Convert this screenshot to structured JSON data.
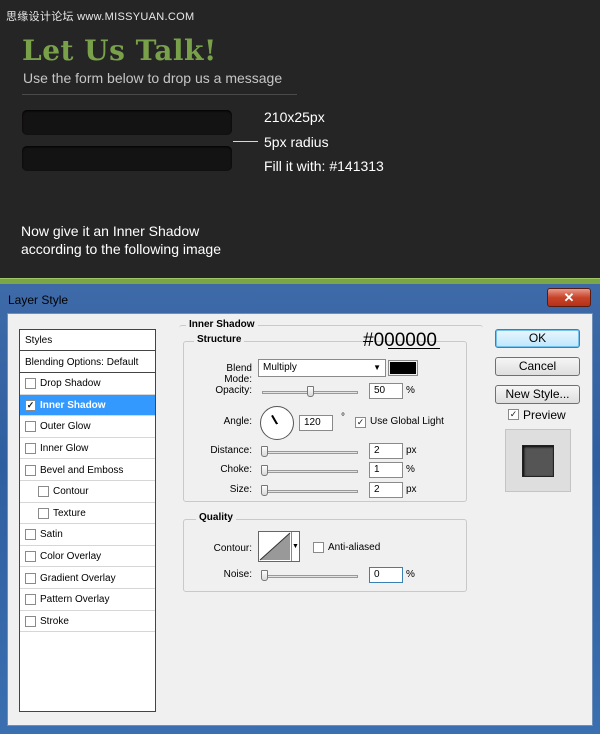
{
  "watermark": "思缘设计论坛 www.MISSYUAN.COM",
  "tutorial": {
    "title": "Let Us Talk!",
    "subtitle": "Use the form below to drop us a message",
    "annotations": [
      "210x25px",
      "5px radius",
      "Fill it with: #141313"
    ],
    "instruction_line1": "Now give it an Inner Shadow",
    "instruction_line2": "according to the following image",
    "field_fill_color": "#141313",
    "title_color": "#79a14a"
  },
  "dialog": {
    "title": "Layer Style",
    "close_label": "✕",
    "styles_header": "Styles",
    "styles_list": [
      {
        "label": "Blending Options: Default",
        "checkbox": false,
        "checked": false,
        "selected": false,
        "indent": false
      },
      {
        "label": "Drop Shadow",
        "checkbox": true,
        "checked": false,
        "selected": false,
        "indent": false
      },
      {
        "label": "Inner Shadow",
        "checkbox": true,
        "checked": true,
        "selected": true,
        "indent": false
      },
      {
        "label": "Outer Glow",
        "checkbox": true,
        "checked": false,
        "selected": false,
        "indent": false
      },
      {
        "label": "Inner Glow",
        "checkbox": true,
        "checked": false,
        "selected": false,
        "indent": false
      },
      {
        "label": "Bevel and Emboss",
        "checkbox": true,
        "checked": false,
        "selected": false,
        "indent": false
      },
      {
        "label": "Contour",
        "checkbox": true,
        "checked": false,
        "selected": false,
        "indent": true
      },
      {
        "label": "Texture",
        "checkbox": true,
        "checked": false,
        "selected": false,
        "indent": true
      },
      {
        "label": "Satin",
        "checkbox": true,
        "checked": false,
        "selected": false,
        "indent": false
      },
      {
        "label": "Color Overlay",
        "checkbox": true,
        "checked": false,
        "selected": false,
        "indent": false
      },
      {
        "label": "Gradient Overlay",
        "checkbox": true,
        "checked": false,
        "selected": false,
        "indent": false
      },
      {
        "label": "Pattern Overlay",
        "checkbox": true,
        "checked": false,
        "selected": false,
        "indent": false
      },
      {
        "label": "Stroke",
        "checkbox": true,
        "checked": false,
        "selected": false,
        "indent": false
      }
    ],
    "panel_title": "Inner Shadow",
    "structure": {
      "label": "Structure",
      "color_note": "#000000",
      "blend_mode_label": "Blend Mode:",
      "blend_mode_value": "Multiply",
      "swatch_color": "#000000",
      "opacity_label": "Opacity:",
      "opacity_value": "50",
      "opacity_unit": "%",
      "angle_label": "Angle:",
      "angle_value": "120",
      "angle_unit": "°",
      "global_light_label": "Use Global Light",
      "distance_label": "Distance:",
      "distance_value": "2",
      "distance_unit": "px",
      "choke_label": "Choke:",
      "choke_value": "1",
      "choke_unit": "%",
      "size_label": "Size:",
      "size_value": "2",
      "size_unit": "px"
    },
    "quality": {
      "label": "Quality",
      "contour_label": "Contour:",
      "anti_aliased_label": "Anti-aliased",
      "noise_label": "Noise:",
      "noise_value": "0",
      "noise_unit": "%"
    },
    "buttons": {
      "ok": "OK",
      "cancel": "Cancel",
      "new_style": "New Style...",
      "preview": "Preview"
    }
  }
}
